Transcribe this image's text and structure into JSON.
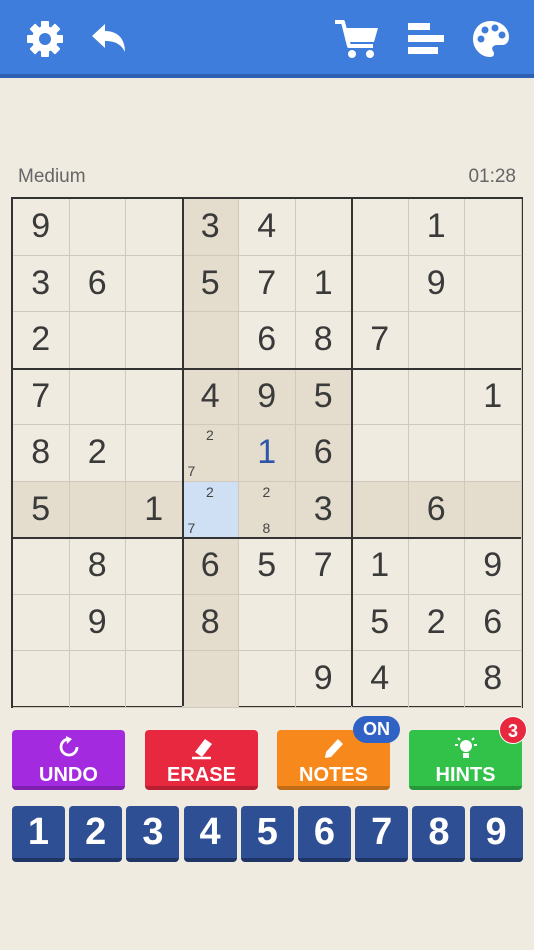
{
  "status": {
    "difficulty": "Medium",
    "timer": "01:28"
  },
  "grid": [
    [
      "9",
      "",
      "",
      "3",
      "4",
      "",
      "",
      "1",
      ""
    ],
    [
      "3",
      "6",
      "",
      "5",
      "7",
      "1",
      "",
      "9",
      ""
    ],
    [
      "2",
      "",
      "",
      "",
      "6",
      "8",
      "7",
      "",
      ""
    ],
    [
      "7",
      "",
      "",
      "4",
      "9",
      "5",
      "",
      "",
      "1"
    ],
    [
      "8",
      "2",
      "",
      "",
      "1",
      "6",
      "",
      "",
      ""
    ],
    [
      "5",
      "",
      "1",
      "",
      "",
      "3",
      "",
      "6",
      ""
    ],
    [
      "",
      "8",
      "",
      "6",
      "5",
      "7",
      "1",
      "",
      "9"
    ],
    [
      "",
      "9",
      "",
      "8",
      "",
      "",
      "5",
      "2",
      "6"
    ],
    [
      "",
      "",
      "",
      "",
      "",
      "9",
      "4",
      "",
      "8"
    ]
  ],
  "selected_cell": {
    "row": 5,
    "col": 3
  },
  "user_entries": [
    {
      "row": 4,
      "col": 4
    }
  ],
  "notes": [
    {
      "row": 4,
      "col": 3,
      "values": [
        "2",
        "7"
      ]
    },
    {
      "row": 5,
      "col": 3,
      "values": [
        "2",
        "7"
      ]
    },
    {
      "row": 5,
      "col": 4,
      "values": [
        "2",
        "8"
      ]
    }
  ],
  "actions": {
    "undo": {
      "label": "UNDO",
      "color": "#a42ae0"
    },
    "erase": {
      "label": "ERASE",
      "color": "#e8283e"
    },
    "notes": {
      "label": "NOTES",
      "color": "#f7891c",
      "badge": "ON"
    },
    "hints": {
      "label": "HINTS",
      "color": "#32c24a",
      "badge": "3"
    }
  },
  "numpad": [
    "1",
    "2",
    "3",
    "4",
    "5",
    "6",
    "7",
    "8",
    "9"
  ],
  "icons": [
    "gear-icon",
    "undo-arrow-icon",
    "cart-icon",
    "leaderboard-icon",
    "palette-icon"
  ],
  "colors": {
    "topbar": "#3f7ddc",
    "numpad": "#2f4f94",
    "selected": "#cfe0f5",
    "highlight": "#e4ddcd"
  }
}
